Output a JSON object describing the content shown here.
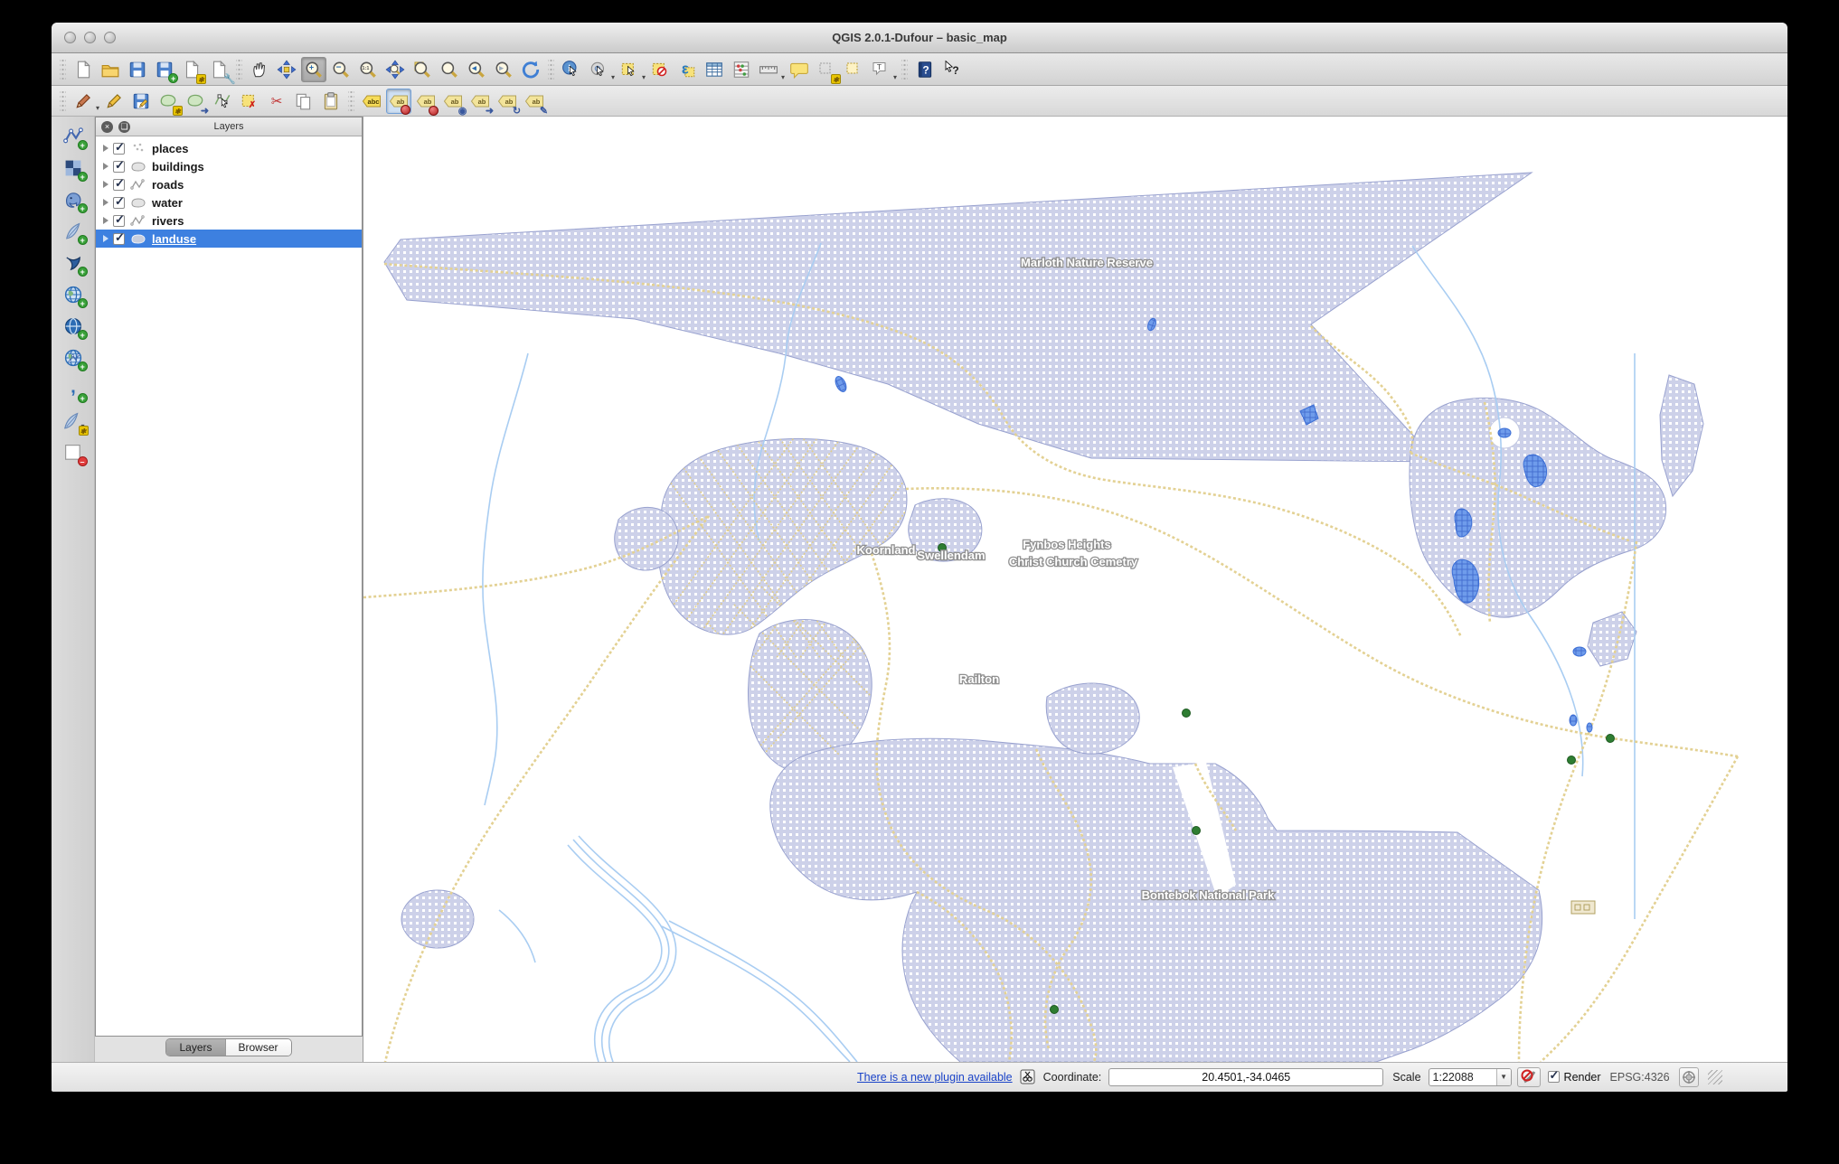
{
  "window": {
    "title": "QGIS 2.0.1-Dufour – basic_map",
    "traffic_lights": [
      "close",
      "minimize",
      "zoom"
    ]
  },
  "toolbars": {
    "row1": [
      "new-project",
      "open-project",
      "save-project",
      "save-project-as",
      "new-print-composer",
      "composer-manager",
      "pan-map",
      "pan-to-selection",
      "zoom-in",
      "zoom-out",
      "zoom-native",
      "zoom-full",
      "zoom-to-selection",
      "zoom-to-layer",
      "zoom-last",
      "zoom-next",
      "refresh-map",
      "identify-features",
      "run-feature-action",
      "select-features",
      "deselect-features",
      "select-by-expression",
      "open-attribute-table",
      "field-calculator",
      "measure",
      "map-tips",
      "new-bookmark",
      "show-bookmarks",
      "text-annotation",
      "help-contents",
      "whats-this"
    ],
    "row2": [
      "current-edits",
      "toggle-editing",
      "save-layer-edits",
      "add-feature",
      "move-feature",
      "node-tool",
      "delete-selected",
      "cut-features",
      "copy-features",
      "paste-features",
      "layer-labeling-options",
      "pin-unpin-labels",
      "highlight-pinned-labels",
      "show-hide-labels",
      "move-label",
      "rotate-label",
      "change-label"
    ],
    "left": [
      "add-vector-layer",
      "add-raster-layer",
      "add-postgis-layer",
      "add-spatialite-layer",
      "add-mssql-layer",
      "add-wms-layer",
      "add-wcs-layer",
      "add-wfs-layer",
      "add-delimited-text-layer",
      "new-shapefile-layer",
      "remove-layer"
    ],
    "active_tool": "zoom-in"
  },
  "layers_panel": {
    "title": "Layers",
    "layers": [
      {
        "label": "places",
        "checked": true,
        "geometry": "point"
      },
      {
        "label": "buildings",
        "checked": true,
        "geometry": "polygon"
      },
      {
        "label": "roads",
        "checked": true,
        "geometry": "line"
      },
      {
        "label": "water",
        "checked": true,
        "geometry": "polygon"
      },
      {
        "label": "rivers",
        "checked": true,
        "geometry": "line"
      },
      {
        "label": "landuse",
        "checked": true,
        "geometry": "polygon",
        "selected": true
      }
    ],
    "bottom_tabs": {
      "tabs": [
        "Layers",
        "Browser"
      ],
      "active": "Layers"
    }
  },
  "map": {
    "labels": {
      "marloth": "Marloth Nature Reserve",
      "koornland": "Koornland",
      "swellendam": "Swellendam",
      "fynbos": "Fynbos Heights",
      "cemetry": "Christ Church Cemetry",
      "railton": "Railton",
      "bontebok": "Bontebok National Park"
    },
    "colors": {
      "landuse_fill": "#cdd1e9",
      "landuse_border": "#99a2cf",
      "water_fill": "#6f9ceb",
      "water_border": "#3c6fd6",
      "road": "#e3d193",
      "river": "#a9cdf2",
      "place_dot": "#2e7d32",
      "label_text": "#ffffff",
      "label_halo": "#909090",
      "background": "#ffffff"
    }
  },
  "status_bar": {
    "plugin_link": "There is a new plugin available",
    "coordinate_label": "Coordinate:",
    "coordinate_value": "20.4501,-34.0465",
    "scale_label": "Scale",
    "scale_value": "1:22088",
    "render_label": "Render",
    "render_checked": true,
    "crs": "EPSG:4326"
  }
}
